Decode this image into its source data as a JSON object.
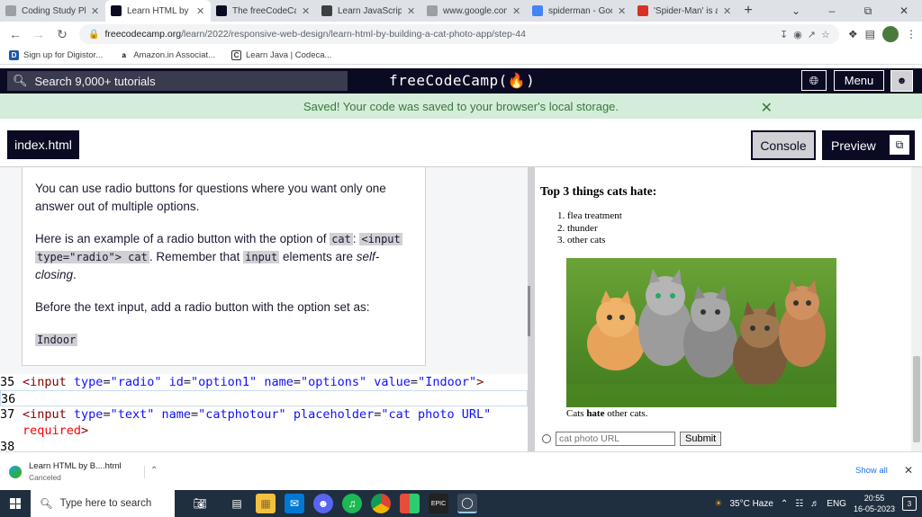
{
  "browser": {
    "tabs": [
      {
        "title": "Coding Study Pla",
        "favicon_color": "#9aa0a6",
        "favicon_glyph": ""
      },
      {
        "title": "Learn HTML by B",
        "favicon_color": "#0a0a23",
        "favicon_glyph": "fcc"
      },
      {
        "title": "The freeCodeCam",
        "favicon_color": "#0a0a23",
        "favicon_glyph": "fcc"
      },
      {
        "title": "Learn JavaScript",
        "favicon_color": "#3c4043",
        "favicon_glyph": "doc"
      },
      {
        "title": "www.google.com",
        "favicon_color": "#9aa0a6",
        "favicon_glyph": "globe"
      },
      {
        "title": "spiderman - Goo",
        "favicon_color": "#4285f4",
        "favicon_glyph": "G"
      },
      {
        "title": "'Spider-Man' is a",
        "favicon_color": "#d93025",
        "favicon_glyph": "news"
      }
    ],
    "active_tab": 1,
    "url_host": "freecodecamp.org",
    "url_path": "/learn/2022/responsive-web-design/learn-html-by-building-a-cat-photo-app/step-44",
    "bookmarks": [
      {
        "label": "Sign up for Digistor...",
        "icon": "digistor-icon"
      },
      {
        "label": "Amazon.in Associat...",
        "icon": "amazon-icon"
      },
      {
        "label": "Learn Java | Codeca...",
        "icon": "codecademy-icon"
      }
    ]
  },
  "fcc": {
    "search_placeholder": "Search 9,000+ tutorials",
    "logo": "freeCodeCamp(🔥)",
    "menu_label": "Menu",
    "saved_message": "Saved! Your code was saved to your browser's local storage.",
    "file_tab": "index.html",
    "console_label": "Console",
    "preview_label": "Preview"
  },
  "instructions": {
    "p1": "You can use radio buttons for questions where you want only one answer out of multiple options.",
    "p2_a": "Here is an example of a radio button with the option of ",
    "p2_code1": "cat",
    "p2_b": ": ",
    "p2_code2a": "<input",
    "p2_code2b": "type=\"radio\"> cat",
    "p2_c": ". Remember that ",
    "p2_code3": "input",
    "p2_d": " elements are ",
    "p2_em": "self-closing",
    "p2_e": ".",
    "p3": "Before the text input, add a radio button with the option set as:",
    "p4_code": "Indoor"
  },
  "editor": {
    "lines": [
      {
        "num": "35"
      },
      {
        "num": "36"
      },
      {
        "num": "37"
      },
      {
        "num": ""
      },
      {
        "num": "38"
      }
    ],
    "line35": {
      "open": "<input",
      "a1": "type",
      "v1": "\"radio\"",
      "a2": "id",
      "v2": "\"option1\"",
      "a3": "name",
      "v3": "\"options\"",
      "a4": "value",
      "v4": "\"Indoor\"",
      "close": ">"
    },
    "line37": {
      "open": "<input",
      "a1": "type",
      "v1": "\"text\"",
      "a2": "name",
      "v2": "\"catphotour\"",
      "a3": "placeholder",
      "v3": "\"cat photo URL\"",
      "a4": "required",
      "close": ">"
    }
  },
  "preview": {
    "heading": "Top 3 things cats hate:",
    "list": [
      "flea treatment",
      "thunder",
      "other cats"
    ],
    "caption_a": "Cats ",
    "caption_b": "hate",
    "caption_c": " other cats.",
    "input_placeholder": "cat photo URL",
    "submit_label": "Submit"
  },
  "download": {
    "file": "Learn HTML by B....html",
    "status": "Canceled",
    "show_all": "Show all"
  },
  "taskbar": {
    "search_placeholder": "Type here to search",
    "weather": "35°C  Haze",
    "lang": "ENG",
    "time": "20:55",
    "date": "16-05-2023",
    "notifications": "3"
  }
}
